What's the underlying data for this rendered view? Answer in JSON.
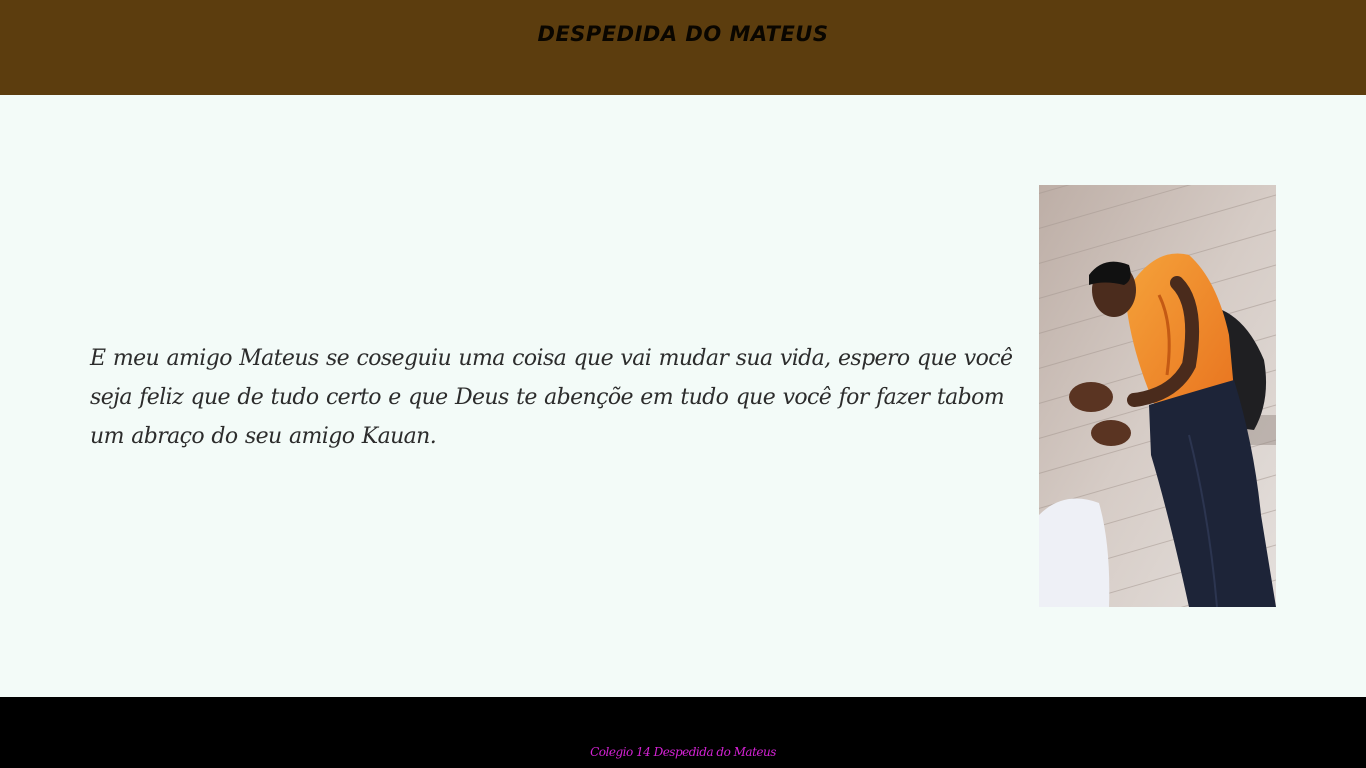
{
  "header": {
    "title": "DESPEDIDA DO MATEUS",
    "background_color": "#5c3d0e"
  },
  "main": {
    "message": "E meu amigo Mateus se coseguiu uma coisa que vai mudar sua vida, espero que você seja feliz que de tudo certo e que Deus te abençõe em tudo que você for fazer tabom um abraço do seu amigo Kauan.",
    "background_color": "#f3fbf8",
    "photo": {
      "alt": "Mateus"
    }
  },
  "footer": {
    "text": "Colegio 14 Despedida do Mateus",
    "text_color": "#d422d4",
    "background_color": "#000000"
  }
}
